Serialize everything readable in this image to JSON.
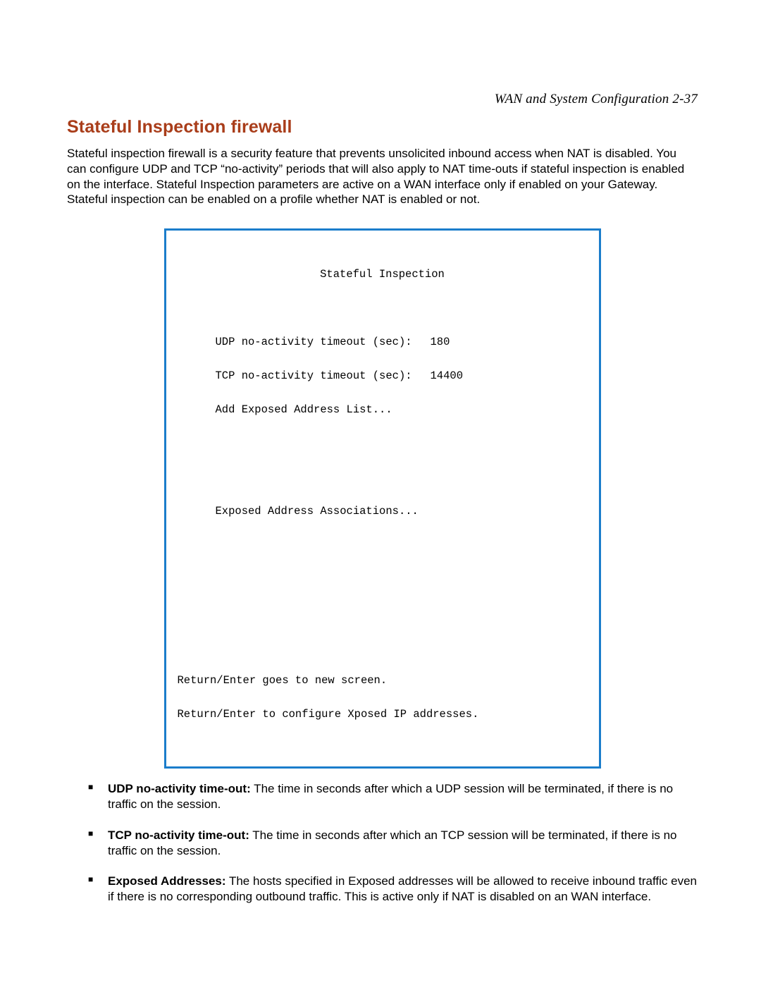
{
  "header": {
    "running_head": "WAN and System Configuration   2-37"
  },
  "section": {
    "title": "Stateful Inspection firewall",
    "intro": "Stateful inspection firewall is a security feature that prevents unsolicited inbound access when NAT is disabled. You can configure UDP and TCP “no-activity” periods that will also apply to NAT time-outs if stateful inspection is enabled on the interface. Stateful Inspection parameters are active on a WAN interface only if enabled on your Gateway. Stateful inspection can be enabled on a profile whether NAT is enabled or not."
  },
  "terminal": {
    "title": "Stateful Inspection",
    "udp_label": "UDP no-activity timeout (sec):",
    "udp_value": "180",
    "tcp_label": "TCP no-activity timeout (sec):",
    "tcp_value": "14400",
    "add_list": "Add Exposed Address List...",
    "assoc": "Exposed Address Associations...",
    "footer1": "Return/Enter goes to new screen.",
    "footer2": "Return/Enter to configure Xposed IP addresses."
  },
  "bullets": {
    "b1_bold": "UDP no-activity time-out:",
    "b1_rest": " The time in seconds after which a UDP session will be terminated, if there is no traffic on the session.",
    "b2_bold": "TCP no-activity time-out:",
    "b2_rest": " The time in seconds after which an TCP session will be terminated, if there is no traffic on the session.",
    "b3_bold": "Exposed Addresses:",
    "b3_rest": " The hosts specified in Exposed addresses will be allowed to receive inbound traffic even if there is no corresponding outbound traffic. This is active only if NAT is disabled on an WAN interface."
  }
}
